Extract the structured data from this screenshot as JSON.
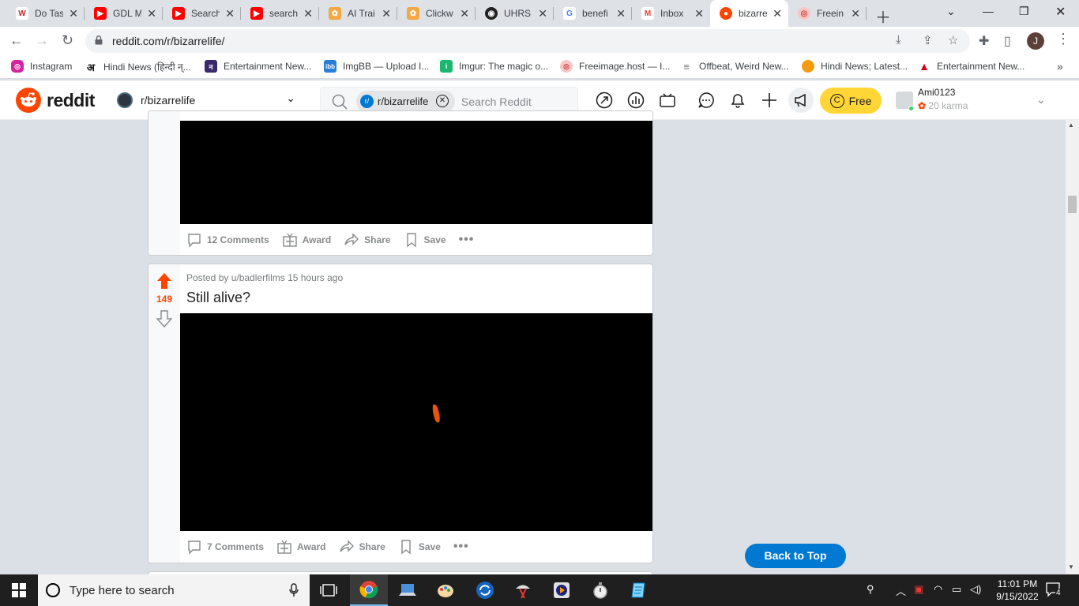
{
  "browser": {
    "tabs": [
      {
        "title": "Do Tas",
        "icon": "w-icon",
        "color": "#c62828",
        "letter": "W"
      },
      {
        "title": "GDL M",
        "icon": "youtube-icon",
        "color": "#ff0000",
        "letter": "▶"
      },
      {
        "title": "Search",
        "icon": "youtube-icon",
        "color": "#ff0000",
        "letter": "▶"
      },
      {
        "title": "search",
        "icon": "youtube-icon",
        "color": "#ff0000",
        "letter": "▶"
      },
      {
        "title": "AI Trai",
        "icon": "clickworker-icon",
        "color": "#f4a742",
        "letter": "✿"
      },
      {
        "title": "Clickw",
        "icon": "clickworker-icon",
        "color": "#f4a742",
        "letter": "✿"
      },
      {
        "title": "UHRS",
        "icon": "uhrs-icon",
        "color": "#222222",
        "letter": "◉"
      },
      {
        "title": "benefi",
        "icon": "google-icon",
        "color": "#ffffff",
        "letter": "G"
      },
      {
        "title": "Inbox",
        "icon": "gmail-icon",
        "color": "#ffffff",
        "letter": "M"
      },
      {
        "title": "bizarre",
        "icon": "reddit-icon",
        "color": "#ff4500",
        "letter": "●"
      },
      {
        "title": "Freein",
        "icon": "freeimage-icon",
        "color": "#f7c6c6",
        "letter": "◎"
      }
    ],
    "active_tab_index": 9,
    "url": "reddit.com/r/bizarrelife/",
    "profile_initial": "J"
  },
  "bookmarks": [
    {
      "label": "Instagram",
      "color": "#d6249f",
      "glyph": "◎"
    },
    {
      "label": "Hindi News (हिन्दी न्...",
      "color": "#111111",
      "glyph": "अ"
    },
    {
      "label": "Entertainment New...",
      "color": "#3b2a6b",
      "glyph": "न"
    },
    {
      "label": "ImgBB — Upload I...",
      "color": "#2a7fd4",
      "glyph": "ibb"
    },
    {
      "label": "Imgur: The magic o...",
      "color": "#1bb76e",
      "glyph": "i"
    },
    {
      "label": "Freeimage.host — I...",
      "color": "#f7c6c6",
      "glyph": "◎"
    },
    {
      "label": "Offbeat, Weird New...",
      "color": "#777777",
      "glyph": "≡"
    },
    {
      "label": "Hindi News; Latest...",
      "color": "#f39c12",
      "glyph": "●"
    },
    {
      "label": "Entertainment New...",
      "color": "#d0021b",
      "glyph": "▲"
    }
  ],
  "reddit": {
    "logo_text": "reddit",
    "subreddit": "r/bizarrelife",
    "search_chip": "r/bizarrelife",
    "search_placeholder": "Search Reddit",
    "free_label": "Free",
    "username": "Ami0123",
    "karma": "20 karma",
    "back_to_top": "Back to Top"
  },
  "posts": [
    {
      "comments": "12 Comments",
      "award": "Award",
      "share": "Share",
      "save": "Save"
    },
    {
      "posted_by": "Posted by u/badlerfilms 15 hours ago",
      "title": "Still alive?",
      "score": "149",
      "comments": "7 Comments",
      "award": "Award",
      "share": "Share",
      "save": "Save"
    }
  ],
  "taskbar": {
    "search_placeholder": "Type here to search",
    "time": "11:01 PM",
    "date": "9/15/2022",
    "notifications": "4"
  },
  "colors": {
    "reddit_orange": "#ff4500",
    "reddit_blue": "#0079d3",
    "free_yellow": "#ffd635"
  }
}
